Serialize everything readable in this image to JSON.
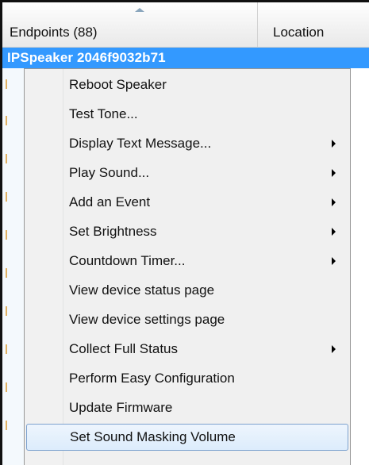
{
  "header": {
    "endpoints_label": "Endpoints (88)",
    "location_label": "Location"
  },
  "selected_row": {
    "label": "IPSpeaker 2046f9032b71"
  },
  "context_menu": {
    "items": [
      {
        "label": "Reboot Speaker",
        "has_submenu": false
      },
      {
        "label": "Test Tone...",
        "has_submenu": false
      },
      {
        "label": "Display Text Message...",
        "has_submenu": true
      },
      {
        "label": "Play Sound...",
        "has_submenu": true
      },
      {
        "label": "Add an Event",
        "has_submenu": true
      },
      {
        "label": "Set Brightness",
        "has_submenu": true
      },
      {
        "label": "Countdown Timer...",
        "has_submenu": true
      },
      {
        "label": "View device status page",
        "has_submenu": false
      },
      {
        "label": "View device settings page",
        "has_submenu": false
      },
      {
        "label": "Collect Full Status",
        "has_submenu": true
      },
      {
        "label": "Perform Easy Configuration",
        "has_submenu": false
      },
      {
        "label": "Update Firmware",
        "has_submenu": false
      },
      {
        "label": "Set Sound Masking Volume",
        "has_submenu": false,
        "highlighted": true
      }
    ]
  },
  "colors": {
    "selection": "#3399ff",
    "menu_background": "#f0f0f0",
    "highlight_border": "#7da2ce"
  }
}
